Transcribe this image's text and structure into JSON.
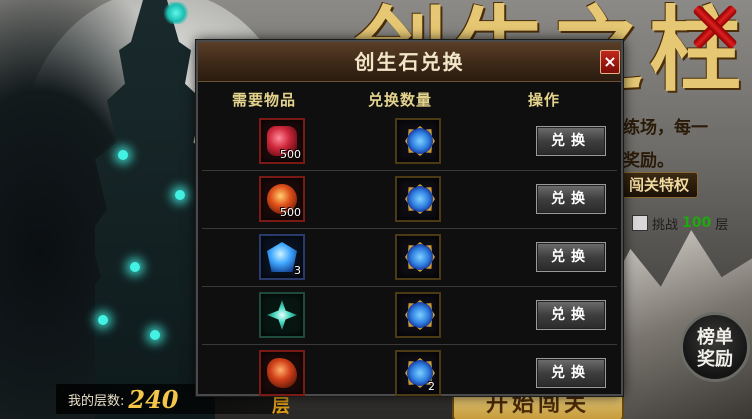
{
  "background": {
    "title": "创生之柱",
    "desc_line1": "练场，每一",
    "desc_line2": "奖励。",
    "privilege_label": "闯关特权",
    "challenge_prefix": "挑战",
    "challenge_floors": "100",
    "challenge_suffix": "层",
    "rank_button_line1": "榜单",
    "rank_button_line2": "奖励",
    "my_floor_label": "我的层数:",
    "my_floor_value": "240",
    "floor_suffix": "层",
    "start_button": "开始闯关"
  },
  "modal": {
    "title": "创生石兑换",
    "close_label": "×",
    "columns": {
      "required": "需要物品",
      "quantity": "兑换数量",
      "action": "操作"
    },
    "rows": [
      {
        "required_icon": "red-crystal-chunk-icon",
        "required_count": "500",
        "reward_icon": "creation-stone-icon",
        "reward_count": "",
        "button": "兑换"
      },
      {
        "required_icon": "red-orb-icon",
        "required_count": "500",
        "reward_icon": "creation-stone-icon",
        "reward_count": "",
        "button": "兑换"
      },
      {
        "required_icon": "blue-crystal-icon",
        "required_count": "3",
        "reward_icon": "creation-stone-icon",
        "reward_count": "",
        "button": "兑换"
      },
      {
        "required_icon": "teal-rune-icon",
        "required_count": "",
        "reward_icon": "creation-stone-icon",
        "reward_count": "",
        "button": "兑换"
      },
      {
        "required_icon": "fire-ore-icon",
        "required_count": "",
        "reward_icon": "creation-stone-icon",
        "reward_count": "2",
        "button": "兑换"
      }
    ]
  },
  "colors": {
    "header_gold": "#e3d38d",
    "title_gold": "#e6c874",
    "close_red": "#c0281c",
    "floor_gold": "#f3c649",
    "challenge_green": "#1fa80f"
  }
}
